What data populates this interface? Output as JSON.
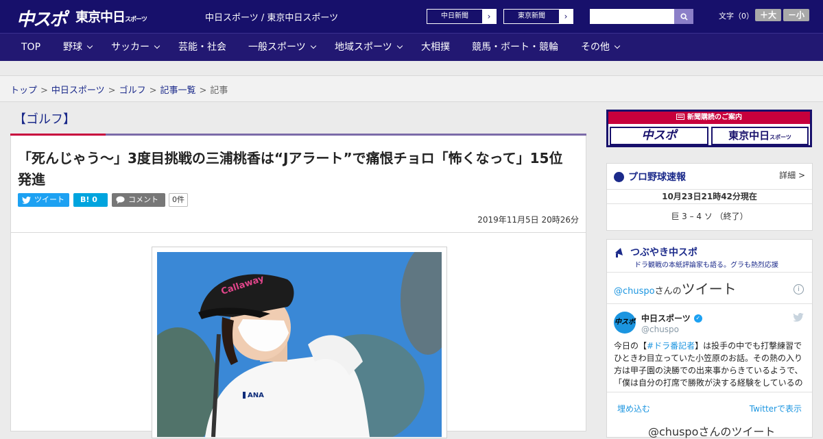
{
  "header": {
    "logo_main": "中スポ",
    "logo_tokyo": "東京中日",
    "logo_tokyo_small": "スポーツ",
    "site_name": "中日スポーツ / 東京中日スポーツ",
    "ext_links": [
      "中日新聞",
      "東京新聞"
    ],
    "search_placeholder": "",
    "font_size_label": "文字（0）",
    "font_larger": "＋大",
    "font_smaller": "－小"
  },
  "nav": {
    "items": [
      {
        "label": "TOP",
        "has_menu": false
      },
      {
        "label": "野球",
        "has_menu": true
      },
      {
        "label": "サッカー",
        "has_menu": true
      },
      {
        "label": "芸能・社会",
        "has_menu": false
      },
      {
        "label": "一般スポーツ",
        "has_menu": true
      },
      {
        "label": "地域スポーツ",
        "has_menu": true
      },
      {
        "label": "大相撲",
        "has_menu": false
      },
      {
        "label": "競馬・ボート・競輪",
        "has_menu": false
      },
      {
        "label": "その他",
        "has_menu": true
      }
    ]
  },
  "breadcrumb": {
    "items": [
      "トップ",
      "中日スポーツ",
      "ゴルフ",
      "記事一覧"
    ],
    "current": "記事",
    "separator": ">"
  },
  "article": {
    "category": "【ゴルフ】",
    "title": "「死んじゃう～」3度目挑戦の三浦桃香は“Jアラート”で痛恨チョロ「怖くなって」15位発進",
    "share": {
      "tweet": "ツイート",
      "hatena": "B! 0",
      "comment": "コメント",
      "comment_count": "0件"
    },
    "date": "2019年11月5日 20時26分"
  },
  "sidebar": {
    "subscribe": {
      "banner": "新聞購読のご案内",
      "logo_left": "中スポ",
      "logo_right": "東京中日",
      "logo_right_small": "スポーツ"
    },
    "baseball": {
      "title": "プロ野球速報",
      "detail": "詳細 >",
      "time": "10月23日21時42分現在",
      "score": "巨 3 – 4 ソ （終了）"
    },
    "tweets": {
      "title": "つぶやき中スポ",
      "subtitle": "ドラ観戦の本紙評論家も語る。グラも熱烈応援",
      "embed_handle": "@chuspo",
      "embed_handle_suffix": "さんの",
      "embed_heading": "ツイート",
      "info": "i",
      "account_name": "中日スポーツ",
      "account_handle": "@chuspo",
      "avatar_text": "中スポ",
      "text_prefix": "今日の【",
      "text_tag": "#ドラ番記者",
      "text_body": "】は投手の中でも打撃練習でひときわ目立っていた小笠原のお話。その熱の入り方は甲子園の決勝での出来事からきているようで、「僕は自分の打席で勝敗が決する経験をしているので",
      "embed_link": "埋め込む",
      "view_on_twitter": "Twitterで表示",
      "footer_text": "@chuspoさんのツイート"
    }
  },
  "colors": {
    "header_bg": "#17106b",
    "nav_bg": "#221872",
    "accent_red": "#c7003c",
    "link_blue": "#1b2a8a",
    "twitter_blue": "#1da1f2"
  }
}
